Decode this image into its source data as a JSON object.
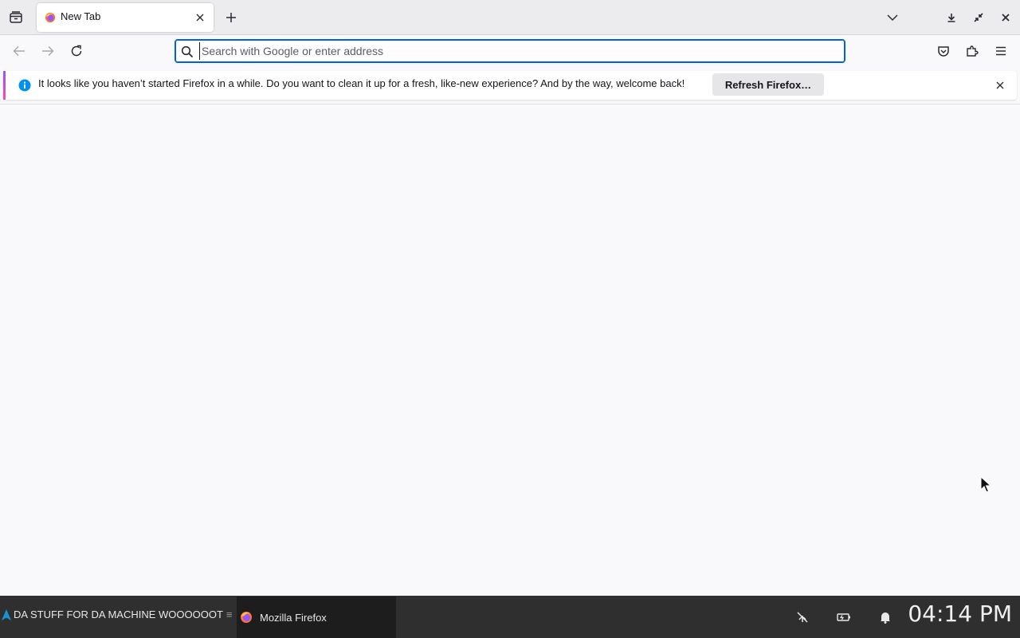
{
  "browser": {
    "tab": {
      "title": "New Tab"
    },
    "urlbar": {
      "placeholder": "Search with Google or enter address",
      "value": ""
    },
    "icons": {
      "tab_overview": "firefox-view-icon",
      "new_tab": "plus-icon",
      "list_tabs": "chevron-down-icon",
      "downloads": "download-icon",
      "restore": "restore-icon",
      "close_window": "close-icon",
      "back": "back-arrow-icon",
      "forward": "forward-arrow-icon",
      "reload": "reload-icon",
      "pocket": "pocket-icon",
      "extensions": "puzzle-icon",
      "menu": "hamburger-menu-icon"
    }
  },
  "notification": {
    "message": "It looks like you haven’t started Firefox in a while. Do you want to clean it up for a fresh, like-new experience? And by the way, welcome back!",
    "button_label": "Refresh Firefox…"
  },
  "taskbar": {
    "start_label": "DA STUFF FOR DA MACHINE WOOOOOOT",
    "task_label": "Mozilla Firefox",
    "clock": "04:14 PM"
  },
  "colors": {
    "accent": "#0061e0",
    "info_blue": "#0090ed",
    "taskbar_bg": "#2f2f30"
  }
}
